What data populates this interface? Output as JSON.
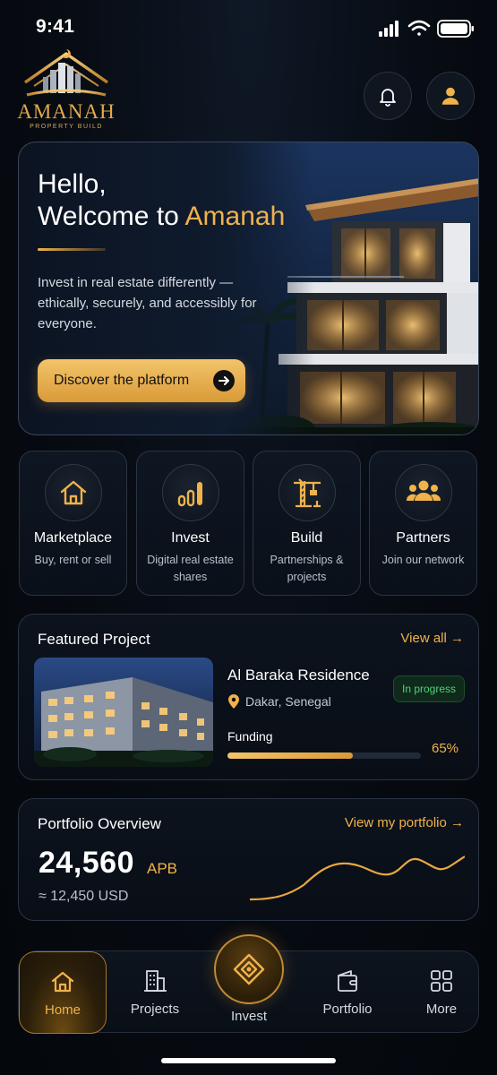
{
  "status_bar": {
    "time": "9:41"
  },
  "brand": {
    "name": "AMANAH",
    "tagline": "PROPERTY BUILD"
  },
  "header": {
    "notifications_icon": "bell-icon",
    "profile_icon": "user-icon"
  },
  "hero": {
    "greeting": "Hello,",
    "welcome_prefix": "Welcome to ",
    "welcome_accent": "Amanah",
    "description": "Invest in real estate differently — ethically, securely, and accessibly for everyone.",
    "cta_label": "Discover the platform"
  },
  "quick_actions": [
    {
      "title": "Marketplace",
      "subtitle": "Buy, rent or sell",
      "icon": "house-icon"
    },
    {
      "title": "Invest",
      "subtitle": "Digital real estate shares",
      "icon": "bar-chart-icon"
    },
    {
      "title": "Build",
      "subtitle": "Partnerships & projects",
      "icon": "crane-icon"
    },
    {
      "title": "Partners",
      "subtitle": "Join our network",
      "icon": "people-icon"
    }
  ],
  "featured": {
    "heading": "Featured Project",
    "view_all": "View all →",
    "project": {
      "name": "Al Baraka Residence",
      "location": "Dakar, Senegal",
      "status": "In progress",
      "funding_label": "Funding",
      "funding_percent_label": "65%",
      "funding_fraction": 0.65
    }
  },
  "portfolio": {
    "heading": "Portfolio Overview",
    "link": "View my portfolio →",
    "value": "24,560",
    "unit": "APB",
    "usd": "≈ 12,450 USD"
  },
  "bottom_nav": {
    "home": "Home",
    "projects": "Projects",
    "invest": "Invest",
    "portfolio": "Portfolio",
    "more": "More"
  },
  "colors": {
    "accent": "#f0b24b",
    "background": "#05080d",
    "success": "#4fd17a"
  }
}
